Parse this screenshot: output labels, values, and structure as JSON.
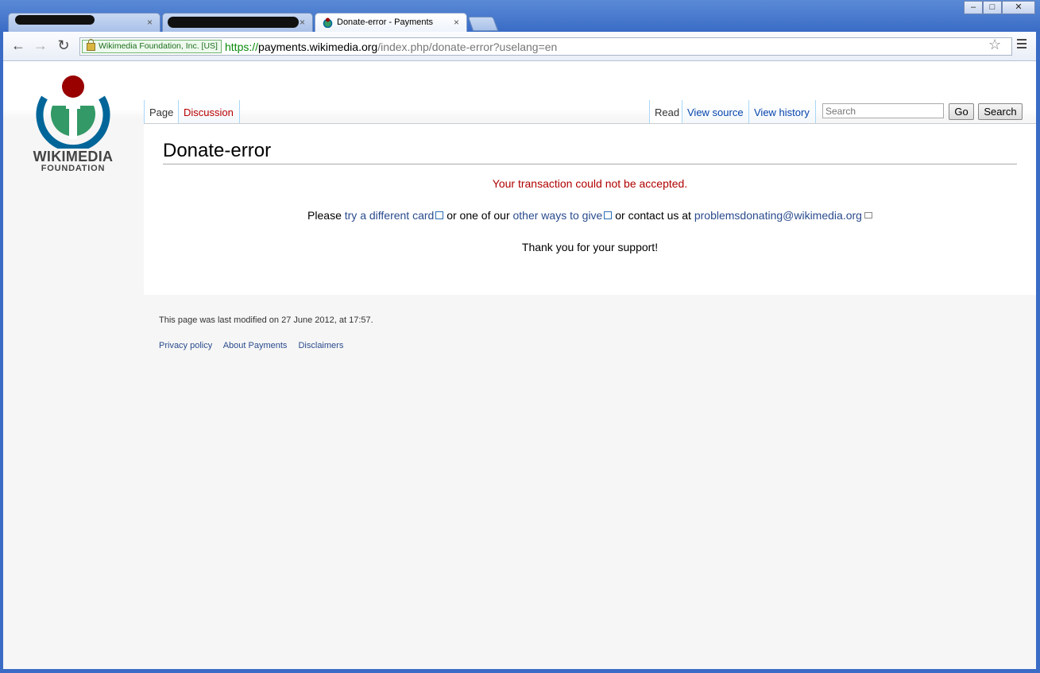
{
  "browser": {
    "tabs": [
      {
        "title": "",
        "close": "×"
      },
      {
        "title": "",
        "close": "×"
      },
      {
        "title": "Donate-error - Payments",
        "close": "×"
      }
    ],
    "window_controls": {
      "minimize": "–",
      "maximize": "□",
      "close": "✕"
    },
    "ev_badge": "Wikimedia Foundation, Inc. [US]",
    "url": {
      "scheme": "https://",
      "host": "payments.wikimedia.org",
      "path": "/index.php/donate-error?uselang=en"
    }
  },
  "logo": {
    "wordmark": "WIKIMEDIA",
    "sub": "FOUNDATION"
  },
  "namespace_tabs": {
    "page": "Page",
    "discussion": "Discussion"
  },
  "view_tabs": {
    "read": "Read",
    "view_source": "View source",
    "view_history": "View history"
  },
  "search": {
    "placeholder": "Search",
    "go": "Go",
    "search": "Search"
  },
  "page": {
    "title": "Donate-error",
    "error": "Your transaction could not be accepted.",
    "please": "Please",
    "link_card": "try a different card",
    "mid1": "or one of our",
    "link_ways": "other ways to give",
    "mid2": "or contact us at",
    "email": "problemsdonating@wikimedia.org",
    "thanks": "Thank you for your support!"
  },
  "footer": {
    "modified": "This page was last modified on 27 June 2012, at 17:57.",
    "links": [
      "Privacy policy",
      "About Payments",
      "Disclaimers"
    ]
  }
}
